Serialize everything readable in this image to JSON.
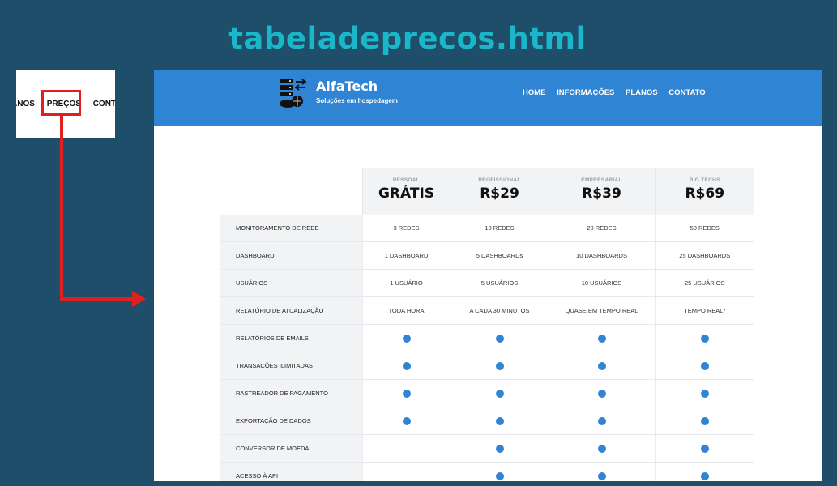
{
  "page_title": "tabeladeprecos.html",
  "nav_zoom": {
    "items": [
      "ANOS",
      "PREÇOS",
      "CONTA"
    ]
  },
  "header": {
    "brand": "AlfaTech",
    "tagline": "Soluções em hospedagem",
    "nav": [
      "HOME",
      "INFORMAÇÕES",
      "PLANOS",
      "CONTATO"
    ]
  },
  "colors": {
    "accent": "#2f84d3",
    "title": "#19b7c9",
    "highlight": "#e0201d",
    "background": "#1e4e6a"
  },
  "plans": [
    {
      "tier": "PESSOAL",
      "price": "GRÁTIS"
    },
    {
      "tier": "PROFISSIONAL",
      "price": "R$29"
    },
    {
      "tier": "EMPRESARIAL",
      "price": "R$39"
    },
    {
      "tier": "BIG TECHS",
      "price": "R$69"
    }
  ],
  "features": [
    {
      "label": "MONITORAMENTO DE REDE",
      "values": [
        "3 REDES",
        "10 REDES",
        "20 REDES",
        "50 REDES"
      ]
    },
    {
      "label": "DASHBOARD",
      "values": [
        "1 DASHBOARD",
        "5 DASHBOARDs",
        "10 DASHBOARDS",
        "25 DASHBOARDS"
      ]
    },
    {
      "label": "USUÁRIOS",
      "values": [
        "1 USUÁRIO",
        "5 USUÁRIOS",
        "10 USUÁRIOS",
        "25 USUÁRIOS"
      ]
    },
    {
      "label": "RELATÓRIO DE ATUALIZAÇÃO",
      "values": [
        "TODA HORA",
        "A CADA 30 MINUTOS",
        "QUASE EM TEMPO REAL",
        "TEMPO REAL*"
      ]
    },
    {
      "label": "RELATÓRIOS DE EMAILS",
      "values": [
        true,
        true,
        true,
        true
      ]
    },
    {
      "label": "TRANSAÇÕES ILIMITADAS",
      "values": [
        true,
        true,
        true,
        true
      ]
    },
    {
      "label": "RASTREADOR DE PAGAMENTO",
      "values": [
        true,
        true,
        true,
        true
      ]
    },
    {
      "label": "EXPORTAÇÃO DE DADOS",
      "values": [
        true,
        true,
        true,
        true
      ]
    },
    {
      "label": "CONVERSOR DE MOEDA",
      "values": [
        false,
        true,
        true,
        true
      ]
    },
    {
      "label": "ACESSO À API",
      "values": [
        false,
        true,
        true,
        true
      ]
    }
  ]
}
